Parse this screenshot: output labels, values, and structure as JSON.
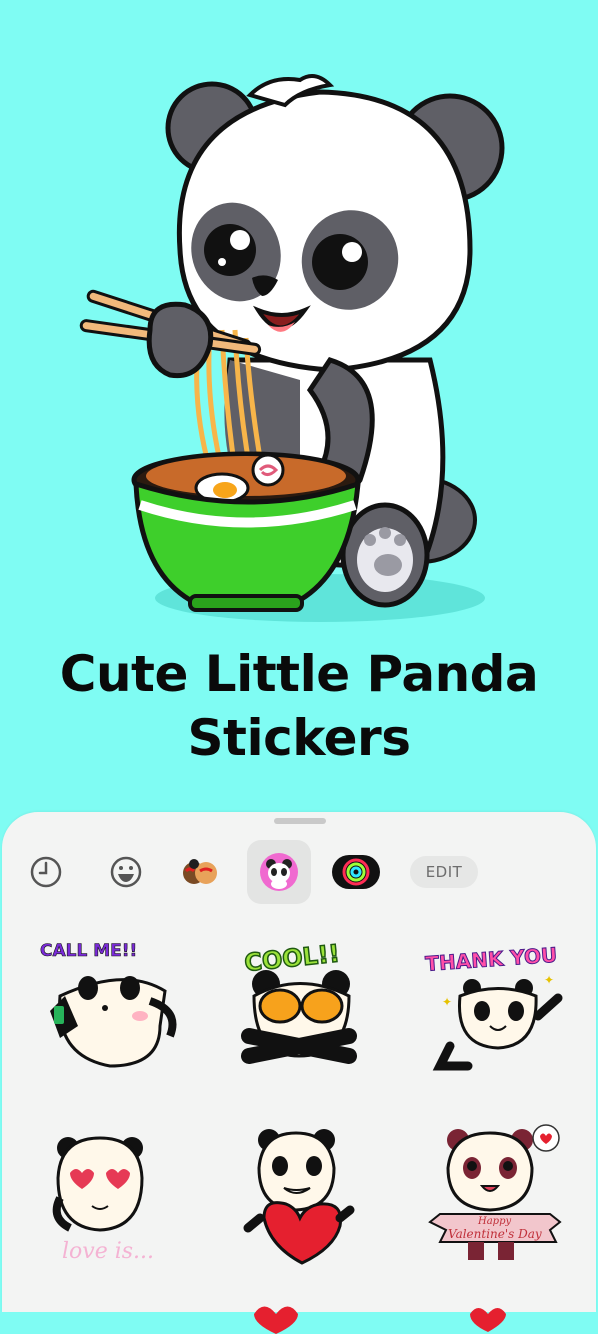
{
  "headline": {
    "line1": "Cute Little Panda",
    "line2": "Stickers"
  },
  "toolbar": {
    "edit_label": "EDIT",
    "selected_tab": "panda-sticker-pack"
  },
  "stickers": {
    "call_me": "CALL ME!!",
    "cool": "COOL!!",
    "thank_you": "THANK YOU",
    "love_is": "love is...",
    "happy": "Happy",
    "valentines": "Valentine's Day"
  },
  "colors": {
    "background": "#7ffcf3",
    "panel": "#f3f4f3",
    "bowl_green": "#3ecf2b"
  }
}
